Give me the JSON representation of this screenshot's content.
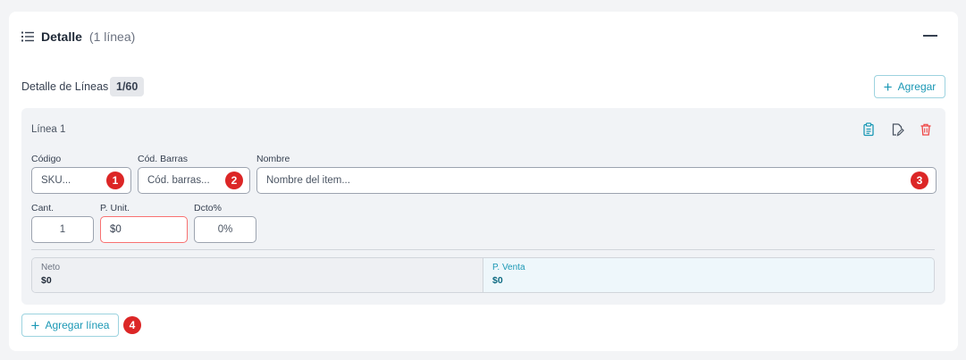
{
  "section": {
    "title": "Detalle",
    "count": "(1 línea)"
  },
  "lines_header": {
    "label": "Detalle de Líneas",
    "badge": "1/60",
    "add_label": "Agregar"
  },
  "line": {
    "title": "Línea 1",
    "fields": {
      "codigo": {
        "label": "Código",
        "placeholder": "SKU..."
      },
      "cod_barras": {
        "label": "Cód. Barras",
        "placeholder": "Cód. barras..."
      },
      "nombre": {
        "label": "Nombre",
        "placeholder": "Nombre del item..."
      },
      "cant": {
        "label": "Cant.",
        "value": "1"
      },
      "p_unit": {
        "label": "P. Unit.",
        "value": "$0"
      },
      "dcto": {
        "label": "Dcto%",
        "value": "0%"
      }
    },
    "totals": {
      "neto": {
        "label": "Neto",
        "value": "$0"
      },
      "p_venta": {
        "label": "P. Venta",
        "value": "$0"
      }
    }
  },
  "add_line_label": "Agregar línea",
  "markers": [
    "1",
    "2",
    "3",
    "4"
  ],
  "colors": {
    "accent": "#1b98b5",
    "marker": "#dc2626",
    "delete": "#ef4444",
    "error_border": "#f87171"
  }
}
